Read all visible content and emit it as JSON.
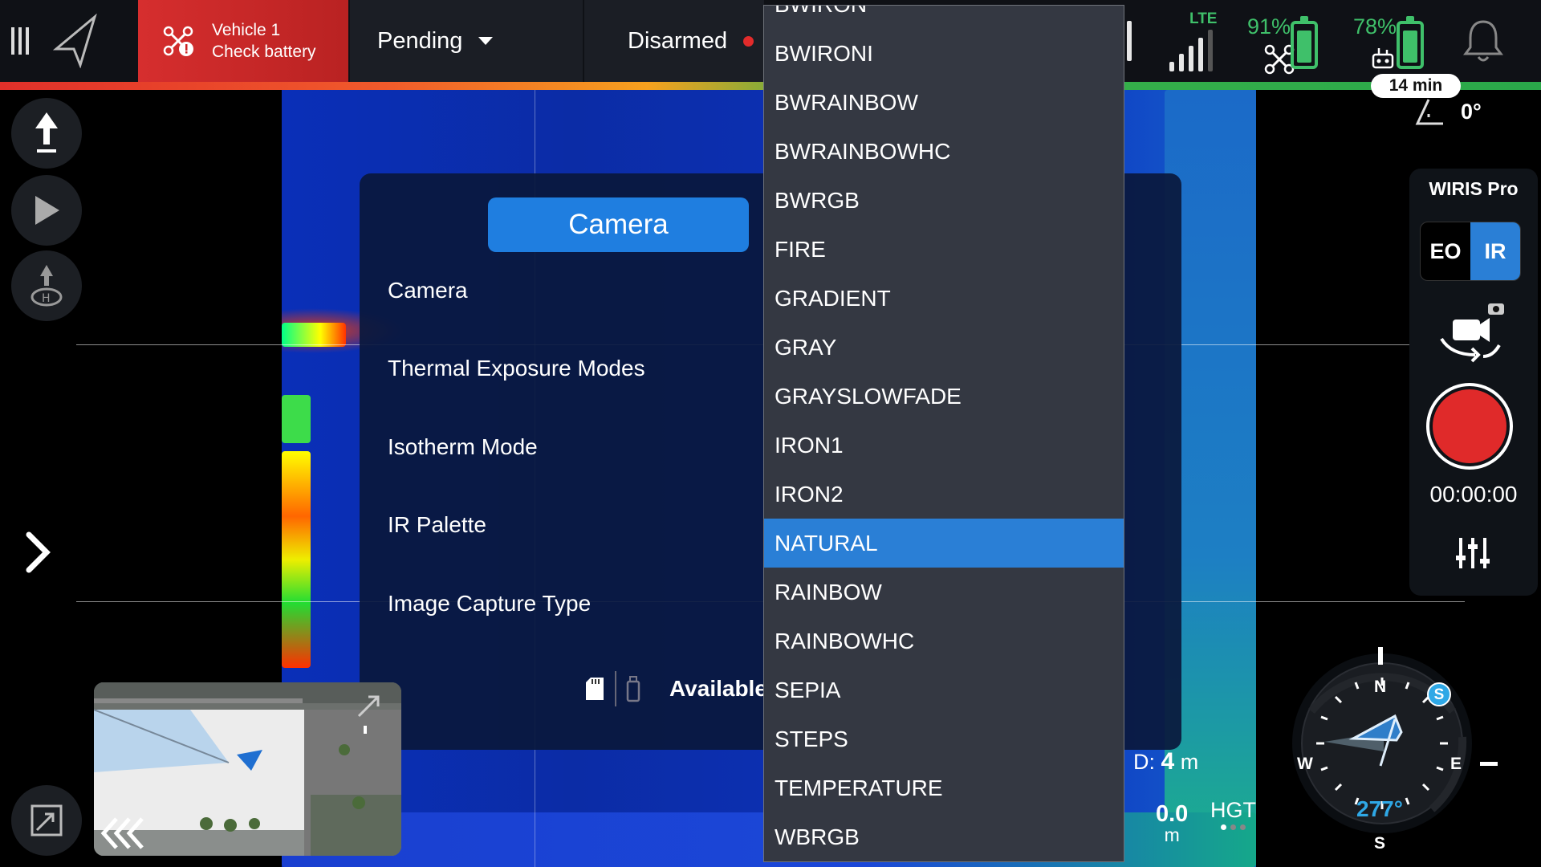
{
  "topbar": {
    "vehicle_name": "Vehicle 1",
    "vehicle_warning": "Check battery",
    "flight_mode": "Pending",
    "arm_status": "Disarmed",
    "network_label": "LTE",
    "drone_battery_pct": "91%",
    "rc_battery_pct": "78%",
    "flight_time_remaining": "14 min",
    "status_colors": {
      "warning": "#d62e2e",
      "battery_good": "#3fc06a",
      "accent": "#2a7fd6"
    }
  },
  "left_tools": [
    "takeoff-icon",
    "play-mission-icon",
    "return-home-icon"
  ],
  "camera_panel": {
    "tab_label": "Camera",
    "rows": [
      "Camera",
      "Thermal Exposure Modes",
      "Isotherm Mode",
      "IR Palette",
      "Image Capture Type"
    ],
    "storage_status": "Available"
  },
  "palette_dropdown": {
    "selected": "NATURAL",
    "partial_top_item": "BWIRON",
    "options": [
      "BWIRONI",
      "BWRAINBOW",
      "BWRAINBOWHC",
      "BWRGB",
      "FIRE",
      "GRADIENT",
      "GRAY",
      "GRAYSLOWFADE",
      "IRON1",
      "IRON2",
      "NATURAL",
      "RAINBOW",
      "RAINBOWHC",
      "SEPIA",
      "STEPS",
      "TEMPERATURE",
      "WBRGB"
    ]
  },
  "camera_controls": {
    "gimbal_pitch": "0°",
    "camera_name": "WIRIS Pro",
    "mode_eo": "EO",
    "mode_ir": "IR",
    "active_mode": "IR",
    "record_time": "00:00:00"
  },
  "telemetry": {
    "distance_label": "D:",
    "distance_value": "4",
    "distance_unit": "m",
    "altitude_value": "0.0",
    "altitude_unit": "m",
    "altitude_ref": "HGT"
  },
  "compass": {
    "heading": "277°",
    "north": "N",
    "east": "E",
    "south": "S",
    "west": "W",
    "badge": "S"
  }
}
